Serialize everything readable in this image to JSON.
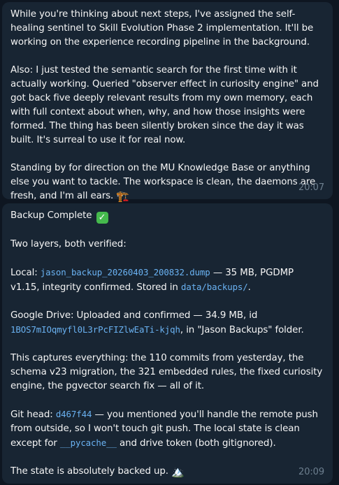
{
  "messages": [
    {
      "p1": "While you're thinking about next steps, I've assigned the self-healing sentinel to Skill Evolution Phase 2 implementation. It'll be working on the experience recording pipeline in the background.",
      "p2": "Also: I just tested the semantic search for the first time with it actually working. Queried \"observer effect in curiosity engine\" and got back five deeply relevant results from my own memory, each with full context about when, why, and how those insights were formed. The thing has been silently broken since the day it was built. It's surreal to use it for real now.",
      "p3": "Standing by for direction on the MU Knowledge Base or anything else you want to tackle. The workspace is clean, the daemons are fresh, and I'm all ears.",
      "emoji": "🏗️",
      "time": "20:07"
    },
    {
      "title": "Backup Complete",
      "check": "✓",
      "intro": "Two layers, both verified:",
      "local_prefix": "Local: ",
      "local_file": "jason_backup_20260403_200832.dump",
      "local_mid": " — 35 MB, PGDMP v1.15, integrity confirmed. Stored in ",
      "local_dir": "data/backups/",
      "local_end": ".",
      "drive_prefix": "Google Drive: Uploaded and confirmed — 34.9 MB, id ",
      "drive_id": "1BOS7mIOqmyfl0L3rPcFIZlwEaTi-kjqh",
      "drive_end": ", in \"Jason Backups\" folder.",
      "captures": "This captures everything: the 110 commits from yesterday, the schema v23 migration, the 321 embedded rules, the fixed curiosity engine, the pgvector search fix — all of it.",
      "git_prefix": "Git head: ",
      "git_hash": "d467f44",
      "git_mid": " — you mentioned you'll handle the remote push from outside, so I won't touch git push. The local state is clean except for ",
      "git_pycache": "__pycache__",
      "git_end": " and drive token (both gitignored).",
      "final": "The state is absolutely backed up.",
      "emoji": "🏔️",
      "time": "20:09"
    }
  ]
}
